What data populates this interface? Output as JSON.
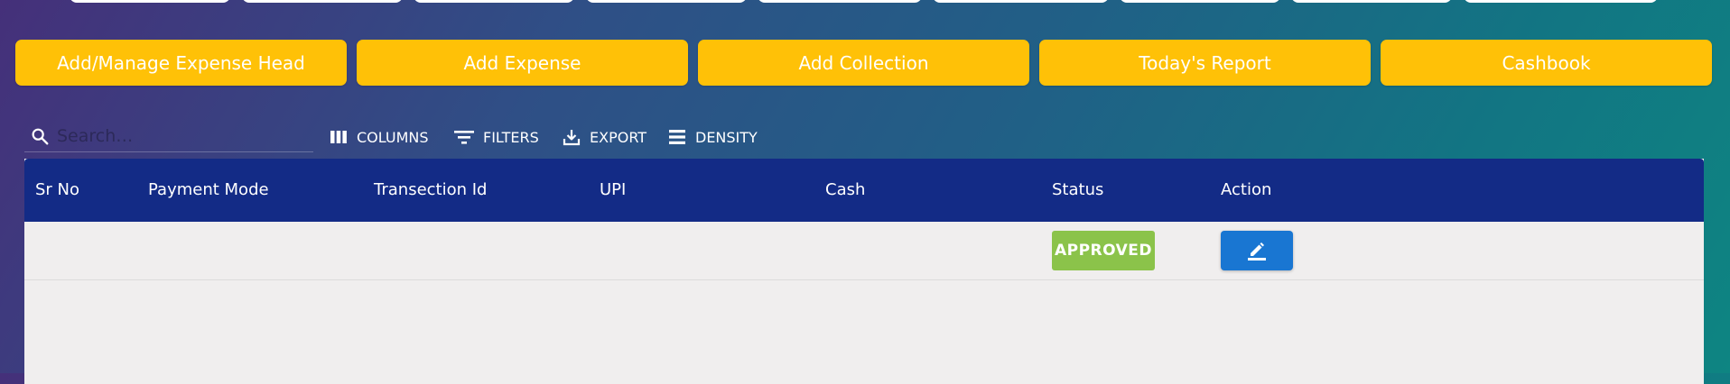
{
  "actions": [
    "Add/Manage Expense Head",
    "Add Expense",
    "Add Collection",
    "Today's Report",
    "Cashbook"
  ],
  "toolbar": {
    "search_placeholder": "Search…",
    "columns_label": "COLUMNS",
    "filters_label": "FILTERS",
    "export_label": "EXPORT",
    "density_label": "DENSITY"
  },
  "grid": {
    "columns": [
      "Sr No",
      "Payment Mode",
      "Transection Id",
      "UPI",
      "Cash",
      "Status",
      "Action"
    ],
    "rows": [
      {
        "sr_no": "",
        "payment_mode": "",
        "transection_id": "",
        "upi": "",
        "cash": "",
        "status": "APPROVED",
        "action_icon": "pencil-icon"
      }
    ]
  },
  "colors": {
    "accent": "#ffc107",
    "header": "#132b86",
    "approved": "#8bc34a",
    "edit": "#1976d2"
  }
}
